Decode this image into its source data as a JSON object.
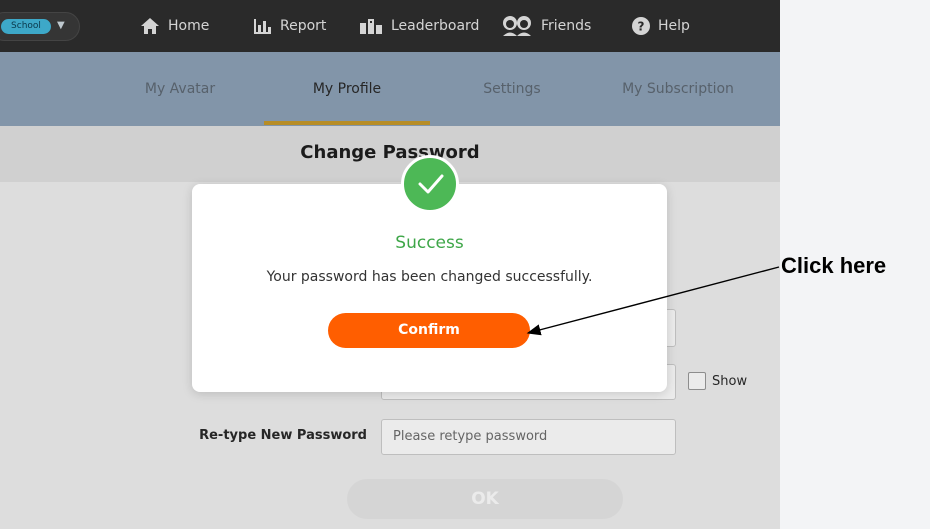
{
  "topbar": {
    "school_label": "School",
    "nav": [
      {
        "label": "Home",
        "icon": "home-icon"
      },
      {
        "label": "Report",
        "icon": "bar-chart-icon"
      },
      {
        "label": "Leaderboard",
        "icon": "leaderboard-icon"
      },
      {
        "label": "Friends",
        "icon": "friends-icon"
      },
      {
        "label": "Help",
        "icon": "help-icon"
      }
    ]
  },
  "tabs": [
    {
      "label": "My Avatar",
      "active": false
    },
    {
      "label": "My Profile",
      "active": true
    },
    {
      "label": "Settings",
      "active": false
    },
    {
      "label": "My Subscription",
      "active": false
    }
  ],
  "page": {
    "section_title": "Change Password",
    "show_label": "Show",
    "retype_label": "Re-type New Password",
    "retype_placeholder": "Please retype password",
    "ok_label": "OK"
  },
  "modal": {
    "title": "Success",
    "message": "Your password has been changed successfully.",
    "confirm_label": "Confirm"
  },
  "annotation": {
    "callout_text": "Click here"
  },
  "colors": {
    "accent_orange": "#ff5e00",
    "success_green": "#4db856",
    "tab_underline": "#c79a2a"
  }
}
